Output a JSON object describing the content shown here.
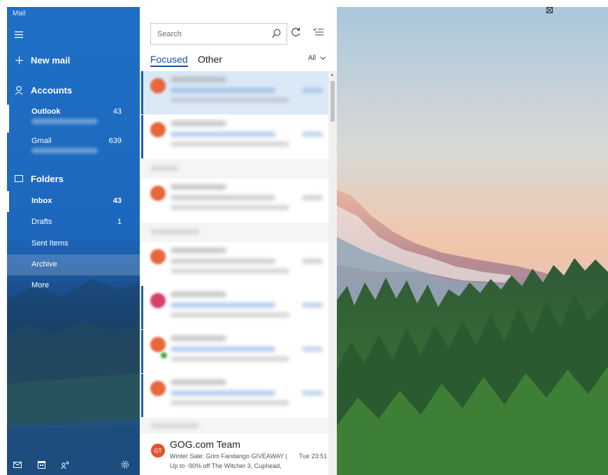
{
  "app": {
    "title": "Mail"
  },
  "sidebar": {
    "new_mail": "New mail",
    "accounts_heading": "Accounts",
    "accounts": [
      {
        "name": "Outlook",
        "count": "43",
        "selected": true
      },
      {
        "name": "Gmail",
        "count": "639",
        "selected": false
      }
    ],
    "folders_heading": "Folders",
    "folders": [
      {
        "name": "Inbox",
        "count": "43",
        "selected": true
      },
      {
        "name": "Drafts",
        "count": "1"
      },
      {
        "name": "Sent Items",
        "count": ""
      },
      {
        "name": "Archive",
        "count": "",
        "highlighted": true
      },
      {
        "name": "More",
        "count": ""
      }
    ],
    "bottom_icons": [
      "mail-icon",
      "calendar-icon",
      "people-icon",
      "settings-icon"
    ]
  },
  "list": {
    "search_placeholder": "Search",
    "tabs": [
      {
        "label": "Focused",
        "active": true
      },
      {
        "label": "Other",
        "active": false
      }
    ],
    "filter_label": "All",
    "visible_message": {
      "avatar_initials": "GT",
      "sender": "GOG.com Team",
      "subject": "Winter Sale: Grim Fandango GIVEAWAY |",
      "time": "Tue 23:51",
      "preview": "Up to -90% off The Witcher 3, Cuphead,"
    }
  },
  "colors": {
    "accent": "#1f6fc7",
    "focused_tab": "#1a4f9c",
    "avatar_orange": "#e8663c",
    "avatar_pink": "#d6416c",
    "badge_green": "#3cae3c"
  }
}
